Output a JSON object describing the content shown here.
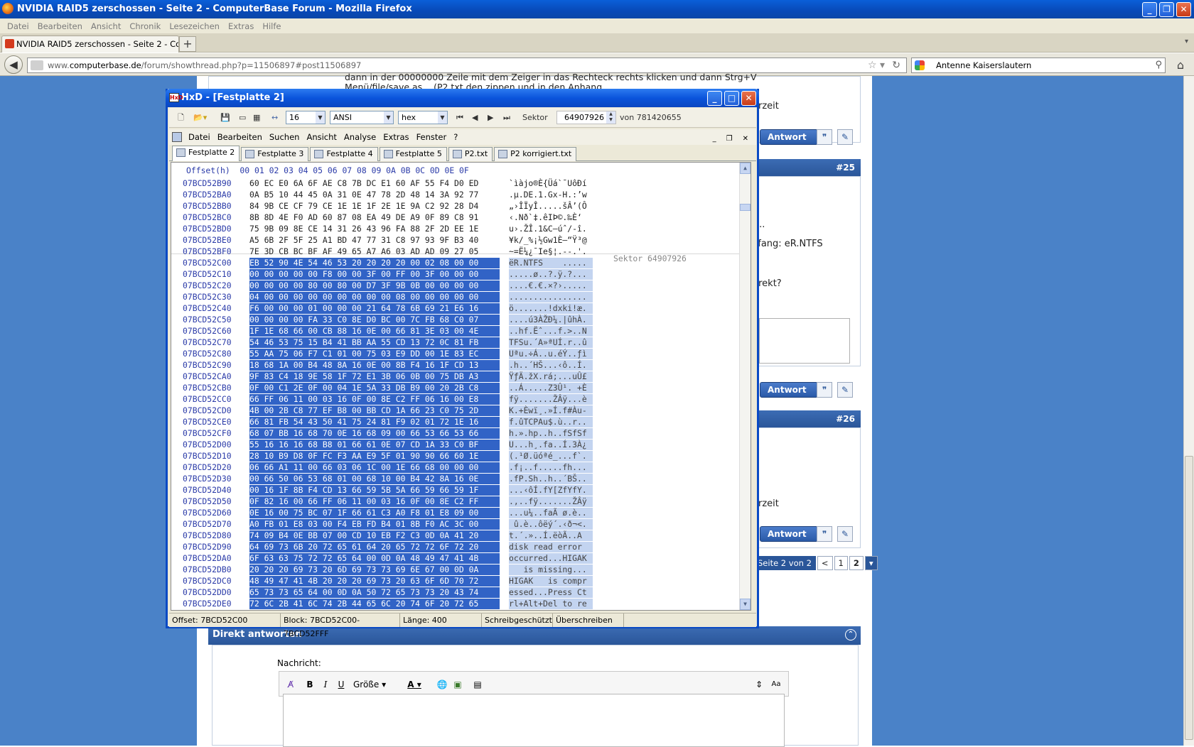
{
  "firefox": {
    "window_title": "NVIDIA RAID5 zerschossen - Seite 2 - ComputerBase Forum - Mozilla Firefox",
    "menu": [
      "Datei",
      "Bearbeiten",
      "Ansicht",
      "Chronik",
      "Lesezeichen",
      "Extras",
      "Hilfe"
    ],
    "tab_title": "NVIDIA RAID5 zerschossen - Seite 2 - Comp...",
    "url_plain": "www.",
    "url_bold": "computerbase.de",
    "url_rest": "/forum/showthread.php?p=11506897#post11506897",
    "search_value": "Antenne Kaiserslautern"
  },
  "forum": {
    "partial_text_top": "dann in der 00000000 Zeile mit dem Zeiger in das Rechteck rechts klicken und dann Strg+V",
    "partial_text_top2": "Menü/file/save as... (P2.txt den zippen und in den Anhang",
    "frag_zeit1": "rzeit",
    "post25_num": "#25",
    "frag_dots": "...",
    "frag_anfang": "nfang: eR.NTFS",
    "frag_korrekt": "rrekt?",
    "post26_num": "#26",
    "frag_zeit2": "rzeit",
    "antwort_label": "Antwort",
    "pager_label": "Seite 2 von 2",
    "pager_prev": "<",
    "pager_p1": "1",
    "pager_p2": "2",
    "direkt_title": "Direkt antworten",
    "nachricht_label": "Nachricht:",
    "groesse_label": "Größe"
  },
  "hxd": {
    "title": "HxD - [Festplatte 2]",
    "bytes_per_row": "16",
    "charset": "ANSI",
    "format": "hex",
    "sektor_label": "Sektor",
    "sektor_value": "64907926",
    "von_label": "von 781420655",
    "menu": [
      "Datei",
      "Bearbeiten",
      "Suchen",
      "Ansicht",
      "Analyse",
      "Extras",
      "Fenster",
      "?"
    ],
    "tabs": [
      "Festplatte 2",
      "Festplatte 3",
      "Festplatte 4",
      "Festplatte 5",
      "P2.txt",
      "P2 korrigiert.txt"
    ],
    "header": "Offset(h)  00 01 02 03 04 05 06 07 08 09 0A 0B 0C 0D 0E 0F",
    "sektor_marker": "Sektor 64907926",
    "rows": [
      {
        "off": "07BCD52B90",
        "hex": "60 EC E0 6A 6F AE C8 7B DC E1 60 AF 55 F4 D0 ED",
        "asc": "`ìàjo®È{Üá`¯UôÐí",
        "sel": false
      },
      {
        "off": "07BCD52BA0",
        "hex": "0A B5 10 44 45 0A 31 0E 47 78 2D 48 14 3A 92 77",
        "asc": ".µ.DE.1.Gx-H.:’w",
        "sel": false
      },
      {
        "off": "07BCD52BB0",
        "hex": "84 9B CE CF 79 CE 1E 1E 1F 2E 1E 9A C2 92 28 D4",
        "asc": "„›ÎÏyÎ.....šÂ’(Ô",
        "sel": false
      },
      {
        "off": "07BCD52BC0",
        "hex": "8B 8D 4E F0 AD 60 87 08 EA 49 DE A9 0F 89 C8 91",
        "asc": "‹.Nð­`‡.êIÞ©.‰È‘",
        "sel": false
      },
      {
        "off": "07BCD52BD0",
        "hex": "75 9B 09 8E CE 14 31 26 43 96 FA 88 2F 2D EE 1E",
        "asc": "u›.ŽÎ.1&C–úˆ/-î.",
        "sel": false
      },
      {
        "off": "07BCD52BE0",
        "hex": "A5 6B 2F 5F 25 A1 BD 47 77 31 C8 97 93 9F B3 40",
        "asc": "¥k/_%¡½Gw1È—“Ÿ³@",
        "sel": false
      },
      {
        "off": "07BCD52BF0",
        "hex": "7E 3D CB BC BF AF 49 65 A7 A6 03 AD AD 09 27 05",
        "asc": "~=Ë¼¿¯Ie§¦.--.'.",
        "sel": false
      },
      {
        "off": "07BCD52C00",
        "hex": "EB 52 90 4E 54 46 53 20 20 20 20 00 02 08 00 00",
        "asc": "ëR.NTFS    .....",
        "sel": true
      },
      {
        "off": "07BCD52C10",
        "hex": "00 00 00 00 00 F8 00 00 3F 00 FF 00 3F 00 00 00",
        "asc": ".....ø..?.ÿ.?...",
        "sel": true
      },
      {
        "off": "07BCD52C20",
        "hex": "00 00 00 00 80 00 80 00 D7 3F 9B 0B 00 00 00 00",
        "asc": "....€.€.×?›.....",
        "sel": true
      },
      {
        "off": "07BCD52C30",
        "hex": "04 00 00 00 00 00 00 00 00 00 08 00 00 00 00 00",
        "asc": "................",
        "sel": true
      },
      {
        "off": "07BCD52C40",
        "hex": "F6 00 00 00 01 00 00 00 21 64 78 6B 69 21 E6 16",
        "asc": "ö.......!dxki!æ.",
        "sel": true
      },
      {
        "off": "07BCD52C50",
        "hex": "00 00 00 00 FA 33 C0 8E D0 BC 00 7C FB 68 C0 07",
        "asc": "....ú3ÀŽÐ¼.|ûhÀ.",
        "sel": true
      },
      {
        "off": "07BCD52C60",
        "hex": "1F 1E 68 66 00 CB 88 16 0E 00 66 81 3E 03 00 4E",
        "asc": "..hf.Ëˆ...f.>..N",
        "sel": true
      },
      {
        "off": "07BCD52C70",
        "hex": "54 46 53 75 15 B4 41 BB AA 55 CD 13 72 0C 81 FB",
        "asc": "TFSu.´A»ªUÍ.r..û",
        "sel": true
      },
      {
        "off": "07BCD52C80",
        "hex": "55 AA 75 06 F7 C1 01 00 75 03 E9 DD 00 1E 83 EC",
        "asc": "Uªu.÷Á..u.éÝ..ƒì",
        "sel": true
      },
      {
        "off": "07BCD52C90",
        "hex": "18 68 1A 00 B4 48 8A 16 0E 00 8B F4 16 1F CD 13",
        "asc": ".h..´HŠ...‹ô..Í.",
        "sel": true
      },
      {
        "off": "07BCD52CA0",
        "hex": "9F 83 C4 18 9E 58 1F 72 E1 3B 06 0B 00 75 DB A3",
        "asc": "ŸƒÄ.žX.rá;...uÛ£",
        "sel": true
      },
      {
        "off": "07BCD52CB0",
        "hex": "0F 00 C1 2E 0F 00 04 1E 5A 33 DB B9 00 20 2B C8",
        "asc": "..Á.....Z3Û¹. +È",
        "sel": true
      },
      {
        "off": "07BCD52CC0",
        "hex": "66 FF 06 11 00 03 16 0F 00 8E C2 FF 06 16 00 E8",
        "asc": "fÿ.......ŽÂÿ...è",
        "sel": true
      },
      {
        "off": "07BCD52CD0",
        "hex": "4B 00 2B C8 77 EF B8 00 BB CD 1A 66 23 C0 75 2D",
        "asc": "K.+Èwï¸.»Í.f#Àu-",
        "sel": true
      },
      {
        "off": "07BCD52CE0",
        "hex": "66 81 FB 54 43 50 41 75 24 81 F9 02 01 72 1E 16",
        "asc": "f.ûTCPAu$.ù..r..",
        "sel": true
      },
      {
        "off": "07BCD52CF0",
        "hex": "68 07 BB 16 68 70 0E 16 68 09 00 66 53 66 53 66",
        "asc": "h.».hp..h..fSfSf",
        "sel": true
      },
      {
        "off": "07BCD52D00",
        "hex": "55 16 16 16 68 B8 01 66 61 0E 07 CD 1A 33 C0 BF",
        "asc": "U...h¸.fa..Í.3À¿",
        "sel": true
      },
      {
        "off": "07BCD52D10",
        "hex": "28 10 B9 D8 0F FC F3 AA E9 5F 01 90 90 66 60 1E",
        "asc": "(.¹Ø.üóªé_...f`.",
        "sel": true
      },
      {
        "off": "07BCD52D20",
        "hex": "06 66 A1 11 00 66 03 06 1C 00 1E 66 68 00 00 00",
        "asc": ".f¡..f.....fh...",
        "sel": true
      },
      {
        "off": "07BCD52D30",
        "hex": "00 66 50 06 53 68 01 00 68 10 00 B4 42 8A 16 0E",
        "asc": ".fP.Sh..h..´BŠ..",
        "sel": true
      },
      {
        "off": "07BCD52D40",
        "hex": "00 16 1F 8B F4 CD 13 66 59 5B 5A 66 59 66 59 1F",
        "asc": "...‹ôÍ.fY[ZfYfY.",
        "sel": true
      },
      {
        "off": "07BCD52D50",
        "hex": "0F 82 16 00 66 FF 06 11 00 03 16 0F 00 8E C2 FF",
        "asc": ".‚..fÿ.......ŽÂÿ",
        "sel": true
      },
      {
        "off": "07BCD52D60",
        "hex": "0E 16 00 75 BC 07 1F 66 61 C3 A0 F8 01 E8 09 00",
        "asc": "...u¼..faÃ ø.è..",
        "sel": true
      },
      {
        "off": "07BCD52D70",
        "hex": "A0 FB 01 E8 03 00 F4 EB FD B4 01 8B F0 AC 3C 00",
        "asc": " û.è..ôëý´.‹ð¬<.",
        "sel": true
      },
      {
        "off": "07BCD52D80",
        "hex": "74 09 B4 0E BB 07 00 CD 10 EB F2 C3 0D 0A 41 20",
        "asc": "t.´.»..Í.ëòÃ..A ",
        "sel": true
      },
      {
        "off": "07BCD52D90",
        "hex": "64 69 73 6B 20 72 65 61 64 20 65 72 72 6F 72 20",
        "asc": "disk read error ",
        "sel": true
      },
      {
        "off": "07BCD52DA0",
        "hex": "6F 63 63 75 72 72 65 64 00 0D 0A 48 49 47 41 4B",
        "asc": "occurred...HIGAK",
        "sel": true
      },
      {
        "off": "07BCD52DB0",
        "hex": "20 20 20 69 73 20 6D 69 73 73 69 6E 67 00 0D 0A",
        "asc": "   is missing...",
        "sel": true
      },
      {
        "off": "07BCD52DC0",
        "hex": "48 49 47 41 4B 20 20 20 69 73 20 63 6F 6D 70 72",
        "asc": "HIGAK   is compr",
        "sel": true
      },
      {
        "off": "07BCD52DD0",
        "hex": "65 73 73 65 64 00 0D 0A 50 72 65 73 73 20 43 74",
        "asc": "essed...Press Ct",
        "sel": true
      },
      {
        "off": "07BCD52DE0",
        "hex": "72 6C 2B 41 6C 74 2B 44 65 6C 20 74 6F 20 72 65",
        "asc": "rl+Alt+Del to re",
        "sel": true
      }
    ],
    "status": {
      "offset": "Offset: 7BCD52C00",
      "block": "Block: 7BCD52C00-7BCD52FFF",
      "length": "Länge: 400",
      "mode1": "Schreibgeschützt",
      "mode2": "Überschreiben"
    }
  }
}
